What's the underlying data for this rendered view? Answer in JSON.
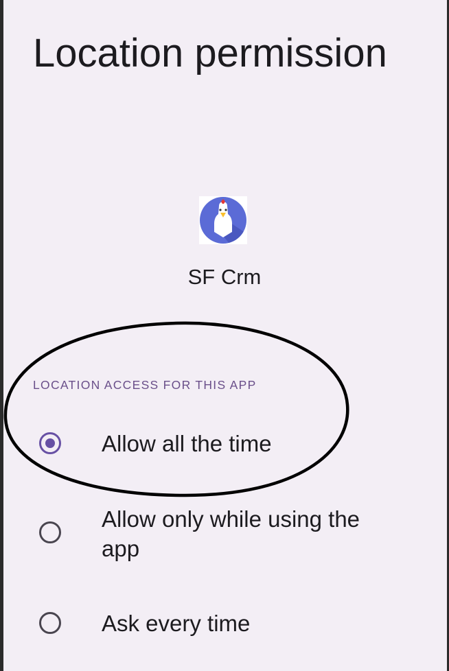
{
  "page": {
    "title": "Location permission"
  },
  "app": {
    "name": "SF Crm",
    "icon": "chicken-app-icon"
  },
  "section": {
    "header": "LOCATION ACCESS FOR THIS APP"
  },
  "options": [
    {
      "label": "Allow all the time",
      "selected": true
    },
    {
      "label": "Allow only while using the app",
      "selected": false
    },
    {
      "label": "Ask every time",
      "selected": false
    }
  ],
  "colors": {
    "background": "#f3eef5",
    "accent": "#6750a4",
    "section_header": "#6a4f8a",
    "icon_background": "#5b6bd6",
    "annotation_stroke": "#000000"
  }
}
